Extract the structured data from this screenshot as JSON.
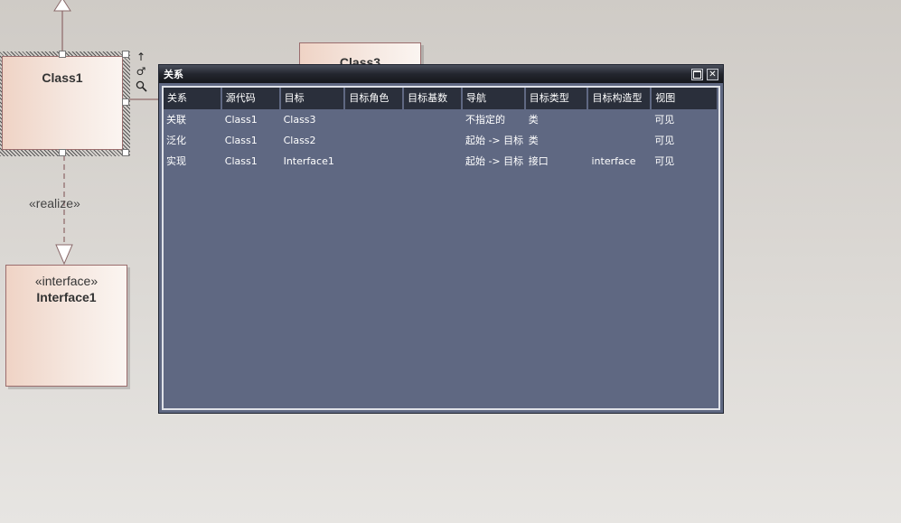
{
  "diagram": {
    "class1": {
      "name": "Class1"
    },
    "class3": {
      "name": "Class3"
    },
    "interface1": {
      "stereotype": "«interface»",
      "name": "Interface1"
    },
    "realize_label": "«realize»",
    "toolbar_icons": [
      "up-arrow-icon",
      "link-icon",
      "zoom-icon"
    ]
  },
  "relations_window": {
    "title": "关系",
    "columns": [
      "关系",
      "源代码",
      "目标",
      "目标角色",
      "目标基数",
      "导航",
      "目标类型",
      "目标构造型",
      "视图"
    ],
    "rows": [
      [
        "关联",
        "Class1",
        "Class3",
        "",
        "",
        "不指定的",
        "类",
        "",
        "可见"
      ],
      [
        "泛化",
        "Class1",
        "Class2",
        "",
        "",
        "起始 -> 目标",
        "类",
        "",
        "可见"
      ],
      [
        "实现",
        "Class1",
        "Interface1",
        "",
        "",
        "起始 -> 目标",
        "接口",
        "interface",
        "可见"
      ]
    ],
    "colors": {
      "body": "#5f6882",
      "header": "#2a2f3b",
      "title_bar": "#16181d"
    }
  }
}
